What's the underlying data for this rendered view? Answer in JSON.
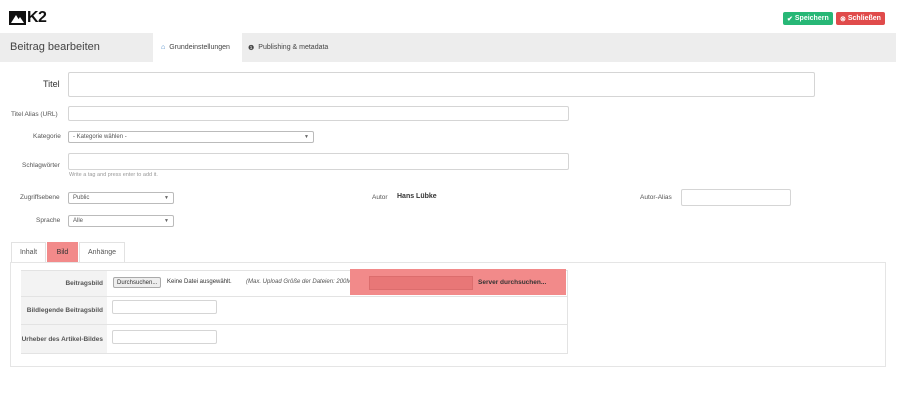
{
  "app": {
    "logo_text": "K2"
  },
  "toolbar": {
    "save_label": "Speichern",
    "close_label": "Schließen",
    "save_color": "#27b776",
    "close_color": "#e04b4b"
  },
  "header": {
    "title": "Beitrag bearbeiten",
    "tabs": [
      {
        "label": "Grundeinstellungen",
        "icon": "home-icon",
        "active": true
      },
      {
        "label": "Publishing & metadata",
        "icon": "info-circle-icon",
        "active": false
      }
    ]
  },
  "form": {
    "title_label": "Titel",
    "title_value": "",
    "alias_label": "Titel Alias (URL)",
    "alias_value": "",
    "category_label": "Kategorie",
    "category_value": "- Kategorie wählen -",
    "tags_label": "Schlagwörter",
    "tags_value": "",
    "tags_help": "Write a tag and press enter to add it.",
    "access_label": "Zugriffsebene",
    "access_value": "Public",
    "author_label": "Autor",
    "author_value": "Hans Lübke",
    "author_alias_label": "Autor-Alias",
    "author_alias_value": "",
    "language_label": "Sprache",
    "language_value": "Alle"
  },
  "content_tabs": [
    {
      "label": "Inhalt",
      "active": false
    },
    {
      "label": "Bild",
      "active": true
    },
    {
      "label": "Anhänge",
      "active": false
    }
  ],
  "image_panel": {
    "image_label": "Beitragsbild",
    "browse_label": "Durchsuchen...",
    "no_file_label": "Keine Datei ausgewählt.",
    "upload_hint": "(Max. Upload Größe der Dateien: 200M) oder",
    "server_field_value": "",
    "server_browse_label": "Server durchsuchen...",
    "caption_label": "Bildlegende Beitragsbild",
    "caption_value": "",
    "credits_label": "Urheber des Artikel-Bildes",
    "credits_value": "",
    "highlight_color": "#f28a8a"
  }
}
